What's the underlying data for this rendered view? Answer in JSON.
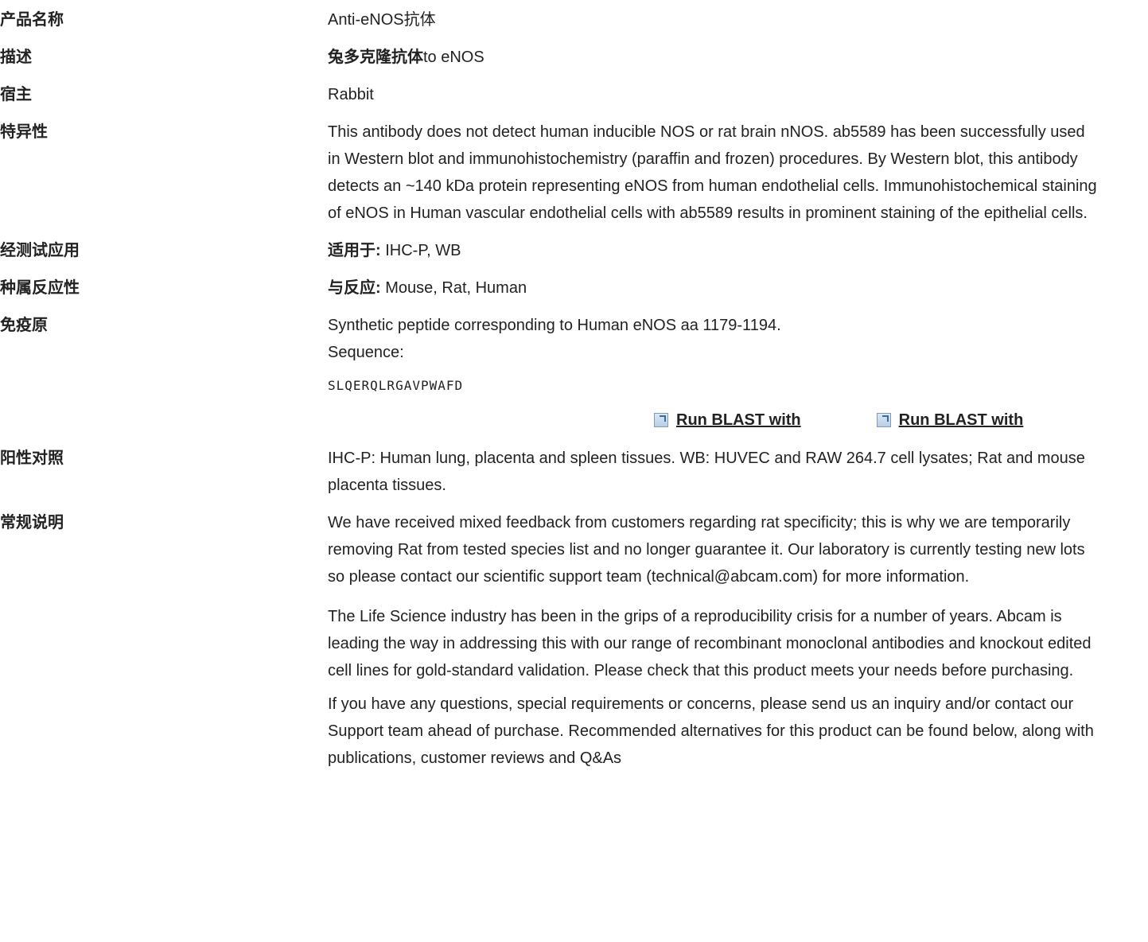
{
  "rows": {
    "name": {
      "label": "产品名称",
      "value": "Anti-eNOS抗体"
    },
    "desc": {
      "label": "描述",
      "value_bold": "兔多克隆抗体",
      "value_rest": "to eNOS"
    },
    "host": {
      "label": "宿主",
      "value": "Rabbit"
    },
    "specificity": {
      "label": "特异性",
      "value": "This antibody does not detect human inducible NOS or rat brain nNOS. ab5589 has been successfully used in Western blot and immunohistochemistry (paraffin and frozen) procedures. By Western blot, this antibody detects an ~140 kDa protein representing eNOS from human endothelial cells. Immunohistochemical staining of eNOS in Human vascular endothelial cells with ab5589 results in prominent staining of the epithelial cells."
    },
    "applications": {
      "label": "经测试应用",
      "value_bold": "适用于:",
      "value_rest": " IHC-P, WB"
    },
    "reactivity": {
      "label": "种属反应性",
      "value_bold": "与反应:",
      "value_rest": " Mouse, Rat, Human"
    },
    "immunogen": {
      "label": "免疫原",
      "line1": "Synthetic peptide corresponding to Human eNOS aa 1179-1194.",
      "line2": "Sequence:",
      "sequence": "SLQERQLRGAVPWAFD",
      "blast1": "Run BLAST with",
      "blast2": "Run BLAST with"
    },
    "positive": {
      "label": "阳性对照",
      "value": "IHC-P: Human lung, placenta and spleen tissues. WB: HUVEC and RAW 264.7 cell lysates; Rat and mouse placenta tissues."
    },
    "notes": {
      "label": "常规说明",
      "p1": "We have received mixed feedback from customers regarding rat specificity; this is why we are temporarily removing Rat from tested species list and no longer guarantee it. Our laboratory is currently testing new lots so please contact our scientific support team (technical@abcam.com) for more information.",
      "p2": "The Life Science industry has been in the grips of a reproducibility crisis for a number of years. Abcam is leading the way in addressing this with our range of recombinant monoclonal antibodies and knockout edited cell lines for gold-standard validation. Please check that this product meets your needs before purchasing.",
      "p3": "If you have any questions, special requirements or concerns, please send us an inquiry and/or contact our Support team ahead of purchase. Recommended alternatives for this product can be found below, along with publications, customer reviews and Q&As"
    }
  }
}
